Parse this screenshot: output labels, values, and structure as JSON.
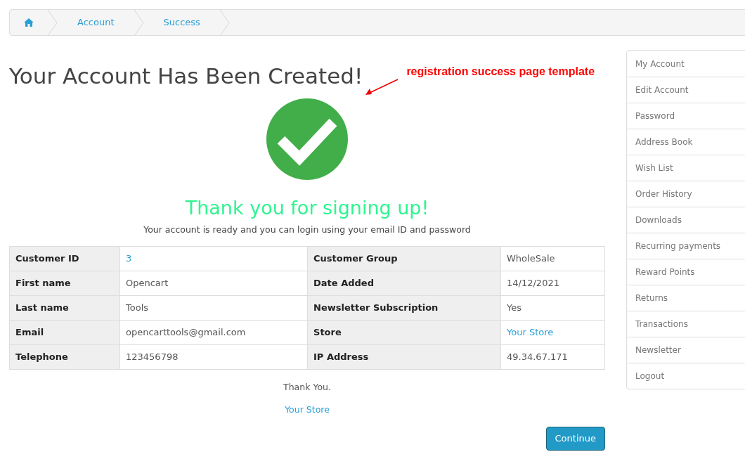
{
  "breadcrumb": [
    {
      "kind": "home"
    },
    {
      "kind": "link",
      "label": "Account"
    },
    {
      "kind": "link",
      "label": "Success"
    }
  ],
  "heading": "Your Account Has Been Created!",
  "annotation": "registration success page template",
  "thanks_title": "Thank you for signing up!",
  "message": "Your account is ready and you can login using your email ID and password",
  "details": [
    {
      "cells": [
        {
          "label": "Customer ID",
          "value": "3",
          "kind": "link"
        },
        {
          "label": "Customer Group",
          "value": "WholeSale",
          "kind": "text"
        }
      ]
    },
    {
      "cells": [
        {
          "label": "First name",
          "value": "Opencart",
          "kind": "text"
        },
        {
          "label": "Date Added",
          "value": "14/12/2021",
          "kind": "text"
        }
      ]
    },
    {
      "cells": [
        {
          "label": "Last name",
          "value": "Tools",
          "kind": "text"
        },
        {
          "label": "Newsletter Subscription",
          "value": "Yes",
          "kind": "text"
        }
      ]
    },
    {
      "cells": [
        {
          "label": "Email",
          "value": "opencarttools@gmail.com",
          "kind": "text"
        },
        {
          "label": "Store",
          "value": "Your Store",
          "kind": "link"
        }
      ]
    },
    {
      "cells": [
        {
          "label": "Telephone",
          "value": "123456798",
          "kind": "text"
        },
        {
          "label": "IP Address",
          "value": "49.34.67.171",
          "kind": "text"
        }
      ]
    }
  ],
  "closing": "Thank You.",
  "store_link": "Your Store",
  "continue_button": "Continue",
  "sidebar": {
    "items": [
      "My Account",
      "Edit Account",
      "Password",
      "Address Book",
      "Wish List",
      "Order History",
      "Downloads",
      "Recurring payments",
      "Reward Points",
      "Returns",
      "Transactions",
      "Newsletter",
      "Logout"
    ]
  }
}
